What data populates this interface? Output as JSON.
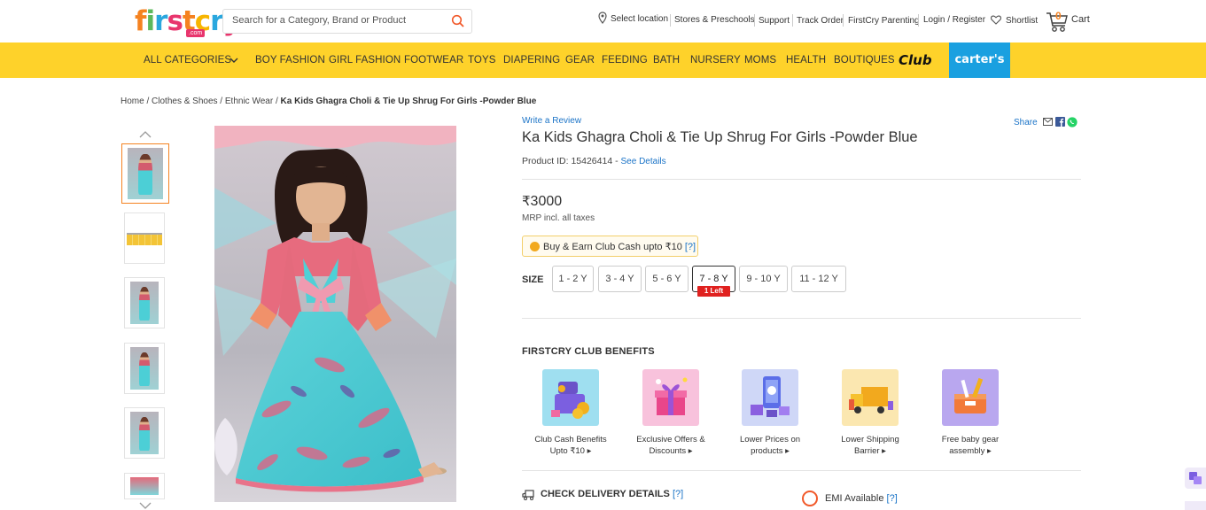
{
  "header": {
    "logo": {
      "f": "f",
      "i": "i",
      "r": "r",
      "s": "s",
      "t": "t",
      "c": "c",
      "r2": "r",
      "y": "y",
      "com": ".com"
    },
    "search_placeholder": "Search for a Category, Brand or Product",
    "select_location": "Select location",
    "stores": "Stores & Preschools",
    "support": "Support",
    "track_order": "Track Order",
    "parenting": "FirstCry Parenting",
    "login": "Login / Register",
    "shortlist": "Shortlist",
    "cart_count": "0",
    "cart": "Cart"
  },
  "nav": {
    "all_categories": "ALL CATEGORIES",
    "items": [
      "BOY FASHION",
      "GIRL FASHION",
      "FOOTWEAR",
      "TOYS",
      "DIAPERING",
      "GEAR",
      "FEEDING",
      "BATH",
      "NURSERY",
      "MOMS",
      "HEALTH",
      "BOUTIQUES"
    ],
    "club": "Club",
    "carters": "carter's"
  },
  "breadcrumb": {
    "home": "Home",
    "cat1": "Clothes & Shoes",
    "cat2": "Ethnic Wear",
    "current": "Ka Kids Ghagra Choli & Tie Up Shrug For Girls -Powder Blue",
    "sep": " / "
  },
  "product": {
    "write_review": "Write a Review",
    "share": "Share",
    "title": "Ka Kids Ghagra Choli & Tie Up Shrug For Girls -Powder Blue",
    "pid_label": "Product ID: 15426414 - ",
    "see_details": "See Details",
    "price_symbol": "₹",
    "price": "3000",
    "mrp_note": "MRP incl. all taxes",
    "clubcash_text": "Buy & Earn Club Cash upto ₹10 ",
    "clubcash_q": "[?]",
    "size_label": "SIZE",
    "sizes": [
      "1 - 2 Y",
      "3 - 4 Y",
      "5 - 6 Y",
      "7 - 8 Y",
      "9 - 10 Y",
      "11 - 12 Y"
    ],
    "selected_size": "7 - 8 Y",
    "one_left": "1 Left"
  },
  "benefits": {
    "title": "FIRSTCRY CLUB BENEFITS",
    "items": [
      {
        "line1": "Club Cash Benefits",
        "line2": "Upto ₹10 ▸"
      },
      {
        "line1": "Exclusive Offers &",
        "line2": "Discounts ▸"
      },
      {
        "line1": "Lower Prices on",
        "line2": "products ▸"
      },
      {
        "line1": "Lower Shipping",
        "line2": "Barrier ▸"
      },
      {
        "line1": "Free baby gear",
        "line2": "assembly ▸"
      }
    ]
  },
  "delivery": {
    "check": "CHECK DELIVERY DETAILS",
    "q": "[?]",
    "emi": "EMI Available",
    "emi_q": "[?]"
  },
  "colors": {
    "nav_bg": "#fed22a",
    "carters_bg": "#1aa0e0",
    "accent_orange": "#f58220",
    "link_blue": "#1a73c7",
    "one_left_red": "#e0211f"
  }
}
